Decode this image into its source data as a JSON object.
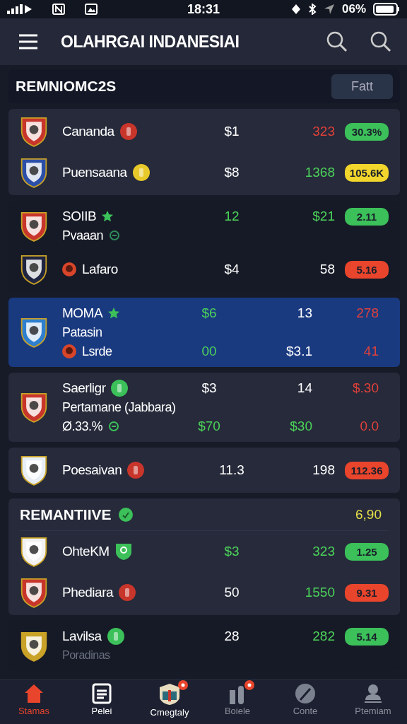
{
  "status_bar": {
    "time": "18:31",
    "battery": "06%"
  },
  "app_bar": {
    "title": "OLAHRGAI INDANESIAI"
  },
  "section": {
    "title": "REMNIOMC2S",
    "button": "Fatt"
  },
  "blocks": [
    {
      "kind": "card",
      "selected": false,
      "rows": [
        {
          "crest": {
            "color": "#c8352b"
          },
          "lines": [
            {
              "text": "Cananda",
              "icon": {
                "kind": "coin",
                "color": "#c8352b"
              },
              "values": [
                {
                  "text": "$1",
                  "color": "#ffffff",
                  "kind": "plain"
                },
                {
                  "text": "323",
                  "color": "#e0413a",
                  "kind": "plain"
                },
                {
                  "text": "30.3%",
                  "color": "#3cc05a",
                  "kind": "pill"
                }
              ]
            }
          ]
        },
        {
          "crest": {
            "color": "#2b4fa8"
          },
          "lines": [
            {
              "text": "Puensaana",
              "icon": {
                "kind": "coin",
                "color": "#e8c92a"
              },
              "values": [
                {
                  "text": "$8",
                  "color": "#ffffff",
                  "kind": "plain"
                },
                {
                  "text": "1368",
                  "color": "#4cd35a",
                  "kind": "plain"
                },
                {
                  "text": "105.6K",
                  "color": "#f2d62c",
                  "kind": "pill"
                }
              ]
            }
          ]
        }
      ]
    },
    {
      "kind": "plain",
      "selected": false,
      "rows": [
        {
          "crest": {
            "color": "#c8352b"
          },
          "lines": [
            {
              "text": "SOIIB",
              "icon": {
                "kind": "star",
                "color": "#3cc05a"
              },
              "values": [
                {
                  "text": "12",
                  "color": "#4cd35a",
                  "kind": "plain"
                },
                {
                  "text": "$21",
                  "color": "#4cd35a",
                  "kind": "plain"
                },
                {
                  "text": "2.11",
                  "color": "#3cc05a",
                  "kind": "pill"
                }
              ]
            },
            {
              "text": "Pvaaan",
              "icon": {
                "kind": "ring",
                "color": "#2f8a5a"
              }
            }
          ]
        },
        {
          "crest": {
            "color": "#1f2440"
          },
          "lines": [
            {
              "text": "Lafaro",
              "icon": {
                "kind": "lead",
                "color": "#d8452a"
              },
              "values": [
                {
                  "text": "$4",
                  "color": "#ffffff",
                  "kind": "plain"
                },
                {
                  "text": "58",
                  "color": "#ffffff",
                  "kind": "plain"
                },
                {
                  "text": "5.16",
                  "color": "#e8452c",
                  "kind": "pill"
                }
              ]
            }
          ]
        }
      ]
    },
    {
      "kind": "card",
      "selected": true,
      "rows": [
        {
          "crest": {
            "color": "#2f7fd0"
          },
          "lines": [
            {
              "text": "MOMA",
              "icon": {
                "kind": "star",
                "color": "#3cc05a"
              },
              "values": [
                {
                  "text": "$6",
                  "color": "#4cd35a",
                  "kind": "plain"
                },
                {
                  "text": "13",
                  "color": "#ffffff",
                  "kind": "plain"
                },
                {
                  "text": "278",
                  "color": "#e0413a",
                  "kind": "plain"
                }
              ]
            },
            {
              "text": "Patasin"
            },
            {
              "text": "Lsrde",
              "icon": {
                "kind": "lead",
                "color": "#d8452a"
              },
              "values": [
                {
                  "text": "00",
                  "color": "#4cd35a",
                  "kind": "plain"
                },
                {
                  "text": "$3.1",
                  "color": "#ffffff",
                  "kind": "plain"
                },
                {
                  "text": "41",
                  "color": "#e0413a",
                  "kind": "plain"
                }
              ]
            }
          ]
        }
      ]
    },
    {
      "kind": "card",
      "selected": false,
      "rows": [
        {
          "crest": {
            "color": "#c8352b"
          },
          "lines": [
            {
              "text": "Saerligr",
              "icon": {
                "kind": "coin",
                "color": "#3cc05a"
              },
              "values": [
                {
                  "text": "$3",
                  "color": "#ffffff",
                  "kind": "plain"
                },
                {
                  "text": "14",
                  "color": "#ffffff",
                  "kind": "plain"
                },
                {
                  "text": "$.30",
                  "color": "#e0413a",
                  "kind": "plain"
                }
              ]
            },
            {
              "text": "Pertamane (Jabbara)"
            },
            {
              "text": "Ø.33.%",
              "icon": {
                "kind": "ring",
                "color": "#3cc05a"
              },
              "values": [
                {
                  "text": "$70",
                  "color": "#4cd35a",
                  "kind": "plain"
                },
                {
                  "text": "$30",
                  "color": "#4cd35a",
                  "kind": "plain"
                },
                {
                  "text": "0.0",
                  "color": "#e0413a",
                  "kind": "plain"
                }
              ]
            }
          ]
        }
      ]
    },
    {
      "kind": "card",
      "selected": false,
      "rows": [
        {
          "crest": {
            "color": "#e8eef5"
          },
          "lines": [
            {
              "text": "Poesaivan",
              "icon": {
                "kind": "coin",
                "color": "#c8352b"
              },
              "values": [
                {
                  "text": "11.3",
                  "color": "#ffffff",
                  "kind": "plain"
                },
                {
                  "text": "198",
                  "color": "#ffffff",
                  "kind": "plain"
                },
                {
                  "text": "112.36",
                  "color": "#e8452c",
                  "kind": "pill"
                }
              ]
            }
          ]
        }
      ]
    },
    {
      "kind": "card",
      "selected": false,
      "header": {
        "text": "REMANTIIVE",
        "icon": {
          "kind": "check",
          "color": "#3cc05a"
        },
        "value": {
          "text": "6,90",
          "color": "#e6e04a"
        }
      },
      "rows": [
        {
          "crest": {
            "color": "#f2f2f2"
          },
          "lines": [
            {
              "text": "OhteKM",
              "icon": {
                "kind": "shield",
                "color": "#3cc05a"
              },
              "values": [
                {
                  "text": "$3",
                  "color": "#4cd35a",
                  "kind": "plain"
                },
                {
                  "text": "323",
                  "color": "#4cd35a",
                  "kind": "plain"
                },
                {
                  "text": "1.25",
                  "color": "#3cc05a",
                  "kind": "pill"
                }
              ]
            }
          ]
        },
        {
          "crest": {
            "color": "#c8352b"
          },
          "lines": [
            {
              "text": "Phediara",
              "icon": {
                "kind": "coin",
                "color": "#c8352b"
              },
              "values": [
                {
                  "text": "50",
                  "color": "#ffffff",
                  "kind": "plain"
                },
                {
                  "text": "1550",
                  "color": "#4cd35a",
                  "kind": "plain"
                },
                {
                  "text": "9.31",
                  "color": "#e8452c",
                  "kind": "pill"
                }
              ]
            }
          ]
        }
      ]
    },
    {
      "kind": "plain",
      "selected": false,
      "rows": [
        {
          "crest": {
            "color": "#c9a227"
          },
          "lines": [
            {
              "text": "Lavilsa",
              "icon": {
                "kind": "coin",
                "color": "#3cc05a"
              },
              "values": [
                {
                  "text": "28",
                  "color": "#ffffff",
                  "kind": "plain"
                },
                {
                  "text": "282",
                  "color": "#4cd35a",
                  "kind": "plain"
                },
                {
                  "text": "5.14",
                  "color": "#3cc05a",
                  "kind": "pill"
                }
              ]
            },
            {
              "text": "Poradinas",
              "dim": true
            }
          ]
        }
      ]
    }
  ],
  "tabs": [
    {
      "label": "Stamas",
      "selected": true,
      "badge": false
    },
    {
      "label": "Pelei",
      "selected": false,
      "badge": false
    },
    {
      "label": "Cmegtaly",
      "selected": false,
      "badge": true
    },
    {
      "label": "Boiele",
      "selected": false,
      "badge": true
    },
    {
      "label": "Conte",
      "selected": false,
      "badge": false
    },
    {
      "label": "Ptemiam",
      "selected": false,
      "badge": false
    }
  ]
}
